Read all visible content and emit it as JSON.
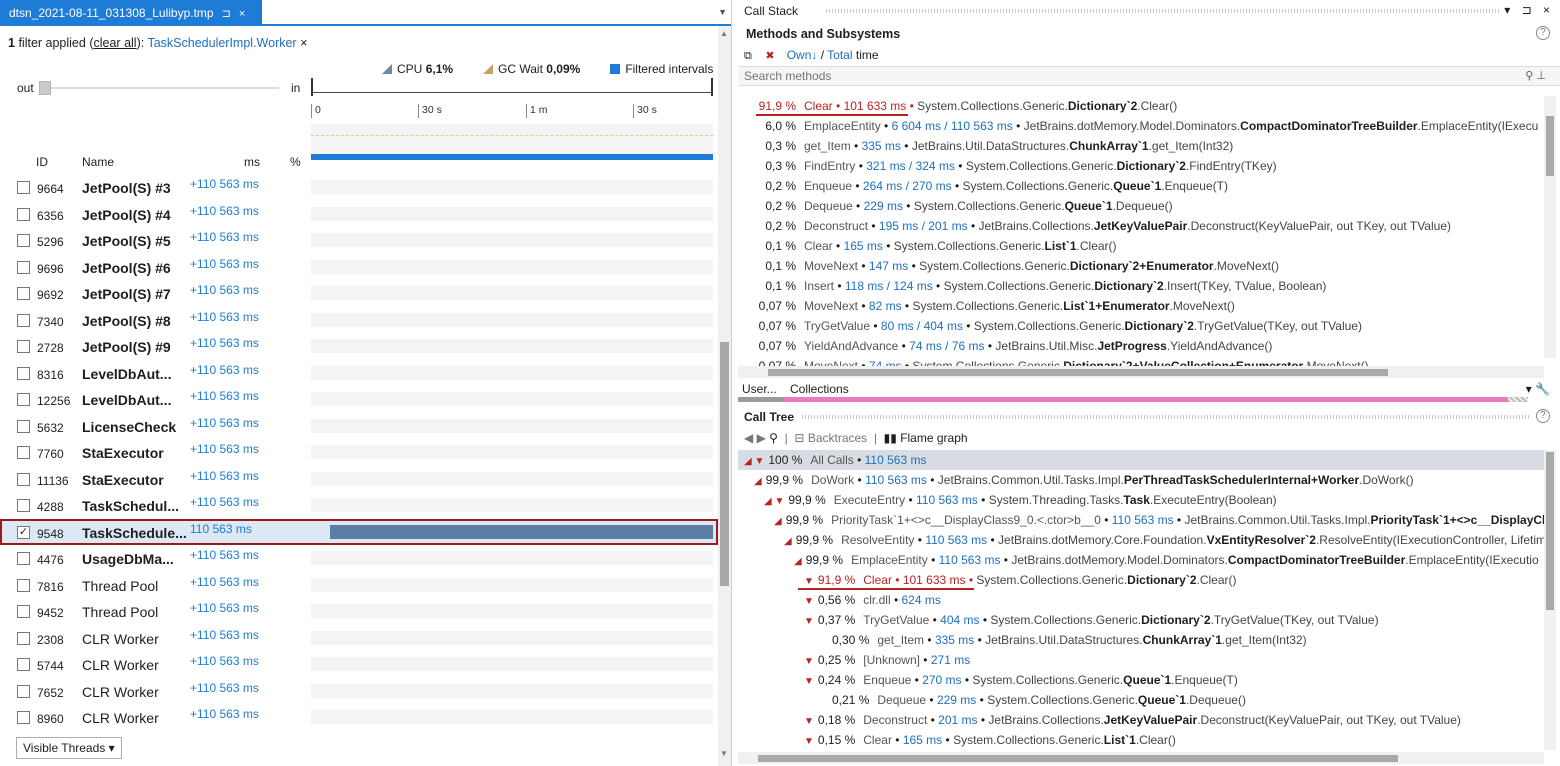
{
  "tab": {
    "title": "dtsn_2021-08-11_031308_Lulibyp.tmp",
    "pin": "⊐",
    "close": "×"
  },
  "filter": {
    "count": "1",
    "text": "filter applied",
    "clear_open": "(",
    "clear": "clear all",
    "clear_close": "):",
    "name": "TaskSchedulerImpl.Worker",
    "remove": "×"
  },
  "legend": {
    "cpu_label": "CPU",
    "cpu_value": "6,1%",
    "gc_label": "GC Wait",
    "gc_value": "0,09%",
    "filtered_label": "Filtered intervals",
    "cpu_color": "#6b8ab0",
    "gc_color": "#c8a068",
    "filtered_color": "#1e7bd6"
  },
  "zoom": {
    "out_label": "out",
    "in_label": "in",
    "level": 0.0
  },
  "ruler": {
    "ticks": [
      "0",
      "30 s",
      "1 m",
      "30 s"
    ]
  },
  "columns": {
    "id": "ID",
    "name": "Name",
    "ms": "ms",
    "pct": "%"
  },
  "threads": [
    {
      "id": "9664",
      "name": "JetPool(S) #3",
      "ms": "+110 563 ms",
      "bold": true,
      "checked": false
    },
    {
      "id": "6356",
      "name": "JetPool(S) #4",
      "ms": "+110 563 ms",
      "bold": true,
      "checked": false
    },
    {
      "id": "5296",
      "name": "JetPool(S) #5",
      "ms": "+110 563 ms",
      "bold": true,
      "checked": false
    },
    {
      "id": "9696",
      "name": "JetPool(S) #6",
      "ms": "+110 563 ms",
      "bold": true,
      "checked": false
    },
    {
      "id": "9692",
      "name": "JetPool(S) #7",
      "ms": "+110 563 ms",
      "bold": true,
      "checked": false
    },
    {
      "id": "7340",
      "name": "JetPool(S) #8",
      "ms": "+110 563 ms",
      "bold": true,
      "checked": false
    },
    {
      "id": "2728",
      "name": "JetPool(S) #9",
      "ms": "+110 563 ms",
      "bold": true,
      "checked": false
    },
    {
      "id": "8316",
      "name": "LevelDbAut...",
      "ms": "+110 563 ms",
      "bold": true,
      "checked": false
    },
    {
      "id": "12256",
      "name": "LevelDbAut...",
      "ms": "+110 563 ms",
      "bold": true,
      "checked": false
    },
    {
      "id": "5632",
      "name": "LicenseCheck",
      "ms": "+110 563 ms",
      "bold": true,
      "checked": false
    },
    {
      "id": "7760",
      "name": "StaExecutor",
      "ms": "+110 563 ms",
      "bold": true,
      "checked": false
    },
    {
      "id": "11136",
      "name": "StaExecutor",
      "ms": "+110 563 ms",
      "bold": true,
      "checked": false
    },
    {
      "id": "4288",
      "name": "TaskSchedul...",
      "ms": "+110 563 ms",
      "bold": true,
      "checked": false
    },
    {
      "id": "9548",
      "name": "TaskSchedule...",
      "ms": "110 563 ms",
      "bold": true,
      "checked": true,
      "selected": true
    },
    {
      "id": "4476",
      "name": "UsageDbMa...",
      "ms": "+110 563 ms",
      "bold": true,
      "checked": false
    },
    {
      "id": "7816",
      "name": "Thread Pool",
      "ms": "+110 563 ms",
      "bold": false,
      "checked": false
    },
    {
      "id": "9452",
      "name": "Thread Pool",
      "ms": "+110 563 ms",
      "bold": false,
      "checked": false
    },
    {
      "id": "2308",
      "name": "CLR Worker",
      "ms": "+110 563 ms",
      "bold": false,
      "checked": false
    },
    {
      "id": "5744",
      "name": "CLR Worker",
      "ms": "+110 563 ms",
      "bold": false,
      "checked": false
    },
    {
      "id": "7652",
      "name": "CLR Worker",
      "ms": "+110 563 ms",
      "bold": false,
      "checked": false
    },
    {
      "id": "8960",
      "name": "CLR Worker",
      "ms": "+110 563 ms",
      "bold": false,
      "checked": false
    }
  ],
  "visible_threads": "Visible Threads ▾",
  "callstack": {
    "title": "Call Stack",
    "controls": "▾ ⊐ ×",
    "section": "Methods and Subsystems",
    "own": "Own↓",
    "slash": " / ",
    "total": "Total",
    "time": " time",
    "search_placeholder": "Search methods"
  },
  "methods": [
    {
      "pct": "91,9 %",
      "method": "Clear",
      "time": "101 633 ms",
      "ns": "System.Collections.Generic.",
      "cls": "Dictionary`2",
      "rest": ".Clear()",
      "hl": true
    },
    {
      "pct": "6,0 %",
      "method": "EmplaceEntity",
      "time": "6 604 ms / 110 563 ms",
      "ns": "JetBrains.dotMemory.Model.Dominators.",
      "cls": "CompactDominatorTreeBuilder",
      "rest": ".EmplaceEntity(IExecu"
    },
    {
      "pct": "0,3 %",
      "method": "get_Item",
      "time": "335 ms",
      "ns": "JetBrains.Util.DataStructures.",
      "cls": "ChunkArray`1",
      "rest": ".get_Item(Int32)"
    },
    {
      "pct": "0,3 %",
      "method": "FindEntry",
      "time": "321 ms / 324 ms",
      "ns": "System.Collections.Generic.",
      "cls": "Dictionary`2",
      "rest": ".FindEntry(TKey)"
    },
    {
      "pct": "0,2 %",
      "method": "Enqueue",
      "time": "264 ms / 270 ms",
      "ns": "System.Collections.Generic.",
      "cls": "Queue`1",
      "rest": ".Enqueue(T)"
    },
    {
      "pct": "0,2 %",
      "method": "Dequeue",
      "time": "229 ms",
      "ns": "System.Collections.Generic.",
      "cls": "Queue`1",
      "rest": ".Dequeue()"
    },
    {
      "pct": "0,2 %",
      "method": "Deconstruct",
      "time": "195 ms / 201 ms",
      "ns": "JetBrains.Collections.",
      "cls": "JetKeyValuePair",
      "rest": ".Deconstruct(KeyValuePair, out TKey, out TValue)"
    },
    {
      "pct": "0,1 %",
      "method": "Clear",
      "time": "165 ms",
      "ns": "System.Collections.Generic.",
      "cls": "List`1",
      "rest": ".Clear()"
    },
    {
      "pct": "0,1 %",
      "method": "MoveNext",
      "time": "147 ms",
      "ns": "System.Collections.Generic.",
      "cls": "Dictionary`2+Enumerator",
      "rest": ".MoveNext()"
    },
    {
      "pct": "0,1 %",
      "method": "Insert",
      "time": "118 ms / 124 ms",
      "ns": "System.Collections.Generic.",
      "cls": "Dictionary`2",
      "rest": ".Insert(TKey, TValue, Boolean)"
    },
    {
      "pct": "0,07 %",
      "method": "MoveNext",
      "time": "82 ms",
      "ns": "System.Collections.Generic.",
      "cls": "List`1+Enumerator",
      "rest": ".MoveNext()"
    },
    {
      "pct": "0,07 %",
      "method": "TryGetValue",
      "time": "80 ms / 404 ms",
      "ns": "System.Collections.Generic.",
      "cls": "Dictionary`2",
      "rest": ".TryGetValue(TKey, out TValue)"
    },
    {
      "pct": "0,07 %",
      "method": "YieldAndAdvance",
      "time": "74 ms / 76 ms",
      "ns": "JetBrains.Util.Misc.",
      "cls": "JetProgress",
      "rest": ".YieldAndAdvance()"
    },
    {
      "pct": "0,07 %",
      "method": "MoveNext",
      "time": "74 ms",
      "ns": "System.Collections.Generic.",
      "cls": "Dictionary`2+ValueCollection+Enumerator",
      "rest": ".MoveNext()"
    }
  ],
  "subsystems": {
    "user": "User...",
    "collections": "Collections",
    "controls": "▾ 🔧"
  },
  "calltree": {
    "title": "Call Tree",
    "backtraces": "Backtraces",
    "flame": "Flame graph"
  },
  "tree": [
    {
      "indent": 0,
      "arrow": "◢ ▼",
      "pct": "100 %",
      "method": "All Calls",
      "time": "110 563 ms",
      "ns": "",
      "cls": "",
      "rest": "",
      "root": true
    },
    {
      "indent": 1,
      "arrow": "◢",
      "pct": "99,9 %",
      "method": "DoWork",
      "time": "110 563 ms",
      "ns": "JetBrains.Common.Util.Tasks.Impl.",
      "cls": "PerThreadTaskSchedulerInternal+Worker",
      "rest": ".DoWork()"
    },
    {
      "indent": 2,
      "arrow": "◢ ▼",
      "pct": "99,9 %",
      "method": "ExecuteEntry",
      "time": "110 563 ms",
      "ns": "System.Threading.Tasks.",
      "cls": "Task",
      "rest": ".ExecuteEntry(Boolean)"
    },
    {
      "indent": 3,
      "arrow": "◢",
      "pct": "99,9 %",
      "method": "PriorityTask`1+<>c__DisplayClass9_0.<.ctor>b__0",
      "time": "110 563 ms",
      "ns": "JetBrains.Common.Util.Tasks.Impl.",
      "cls": "PriorityTask`1+<>c__DisplayCla",
      "rest": ""
    },
    {
      "indent": 4,
      "arrow": "◢",
      "pct": "99,9 %",
      "method": "ResolveEntity",
      "time": "110 563 ms",
      "ns": "JetBrains.dotMemory.Core.Foundation.",
      "cls": "VxEntityResolver`2",
      "rest": ".ResolveEntity(IExecutionController, Lifetim"
    },
    {
      "indent": 5,
      "arrow": "◢",
      "pct": "99,9 %",
      "method": "EmplaceEntity",
      "time": "110 563 ms",
      "ns": "JetBrains.dotMemory.Model.Dominators.",
      "cls": "CompactDominatorTreeBuilder",
      "rest": ".EmplaceEntity(IExecutio"
    },
    {
      "indent": 6,
      "arrow": "▼",
      "pct": "91,9 %",
      "method": "Clear",
      "time": "101 633 ms",
      "ns": "System.Collections.Generic.",
      "cls": "Dictionary`2",
      "rest": ".Clear()",
      "hl": true
    },
    {
      "indent": 6,
      "arrow": "▼",
      "pct": "0,56 %",
      "method": "clr.dll",
      "time": "624 ms",
      "ns": "",
      "cls": "",
      "rest": ""
    },
    {
      "indent": 6,
      "arrow": "▼",
      "pct": "0,37 %",
      "method": "TryGetValue",
      "time": "404 ms",
      "ns": "System.Collections.Generic.",
      "cls": "Dictionary`2",
      "rest": ".TryGetValue(TKey, out TValue)"
    },
    {
      "indent": 7,
      "arrow": "",
      "pct": "0,30 %",
      "method": "get_Item",
      "time": "335 ms",
      "ns": "JetBrains.Util.DataStructures.",
      "cls": "ChunkArray`1",
      "rest": ".get_Item(Int32)"
    },
    {
      "indent": 6,
      "arrow": "▼",
      "pct": "0,25 %",
      "method": "[Unknown]",
      "time": "271 ms",
      "ns": "",
      "cls": "",
      "rest": ""
    },
    {
      "indent": 6,
      "arrow": "▼",
      "pct": "0,24 %",
      "method": "Enqueue",
      "time": "270 ms",
      "ns": "System.Collections.Generic.",
      "cls": "Queue`1",
      "rest": ".Enqueue(T)"
    },
    {
      "indent": 7,
      "arrow": "",
      "pct": "0,21 %",
      "method": "Dequeue",
      "time": "229 ms",
      "ns": "System.Collections.Generic.",
      "cls": "Queue`1",
      "rest": ".Dequeue()"
    },
    {
      "indent": 6,
      "arrow": "▼",
      "pct": "0,18 %",
      "method": "Deconstruct",
      "time": "201 ms",
      "ns": "JetBrains.Collections.",
      "cls": "JetKeyValuePair",
      "rest": ".Deconstruct(KeyValuePair, out TKey, out TValue)"
    },
    {
      "indent": 6,
      "arrow": "▼",
      "pct": "0,15 %",
      "method": "Clear",
      "time": "165 ms",
      "ns": "System.Collections.Generic.",
      "cls": "List`1",
      "rest": ".Clear()"
    }
  ]
}
